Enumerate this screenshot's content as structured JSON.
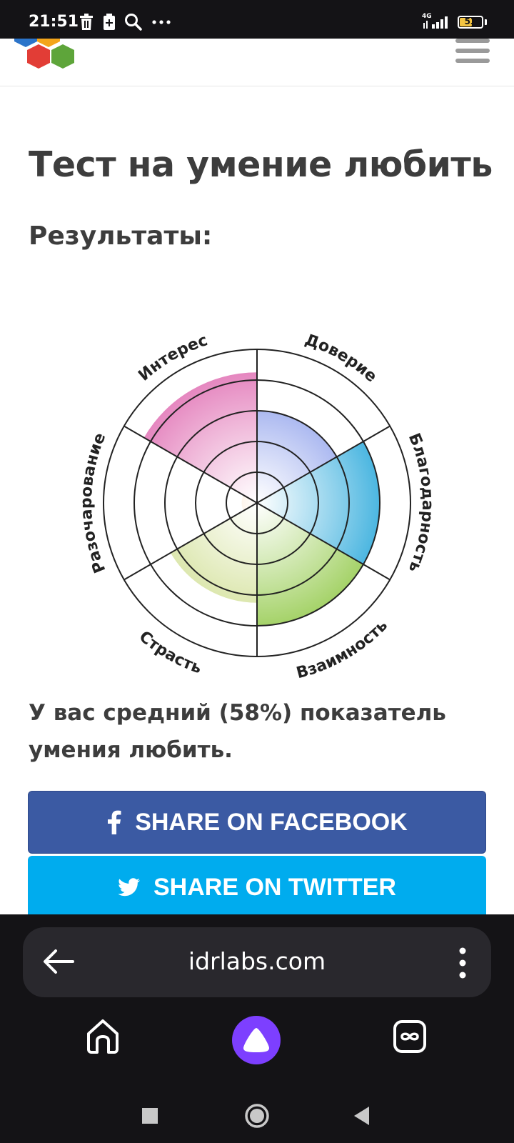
{
  "status_bar": {
    "time": "21:51",
    "network": "4G",
    "battery": "53",
    "icons": [
      "trash-icon",
      "battery-saver-icon",
      "search-icon",
      "more-icon"
    ]
  },
  "header": {
    "logo": "hexagon-logo",
    "menu_icon": "hamburger-icon"
  },
  "main": {
    "title": "Тест на умение любить",
    "results_heading": "Результаты:",
    "result_text": "У вас средний (58%) показатель умения любить."
  },
  "chart_data": {
    "type": "polar-area",
    "categories": [
      "Доверие",
      "Благодарность",
      "Взаимность",
      "Страсть",
      "Разочарование",
      "Интерес"
    ],
    "values": [
      60,
      80,
      80,
      65,
      10,
      85
    ],
    "colors": [
      "#6f86e6",
      "#1aa2d8",
      "#8cc63f",
      "#c8d980",
      "#f08a24",
      "#e06fb3"
    ],
    "rings": 5,
    "ylim": [
      0,
      100
    ]
  },
  "share": {
    "facebook_label": "SHARE ON FACEBOOK",
    "twitter_label": "SHARE ON TWITTER"
  },
  "browser": {
    "url": "idrlabs.com",
    "back_icon": "back-arrow-icon",
    "menu_icon": "more-vertical-icon",
    "nav": [
      "home-icon",
      "alice-assistant-icon",
      "tabs-icon"
    ]
  },
  "system_nav": [
    "square-icon",
    "circle-icon",
    "back-triangle-icon"
  ]
}
